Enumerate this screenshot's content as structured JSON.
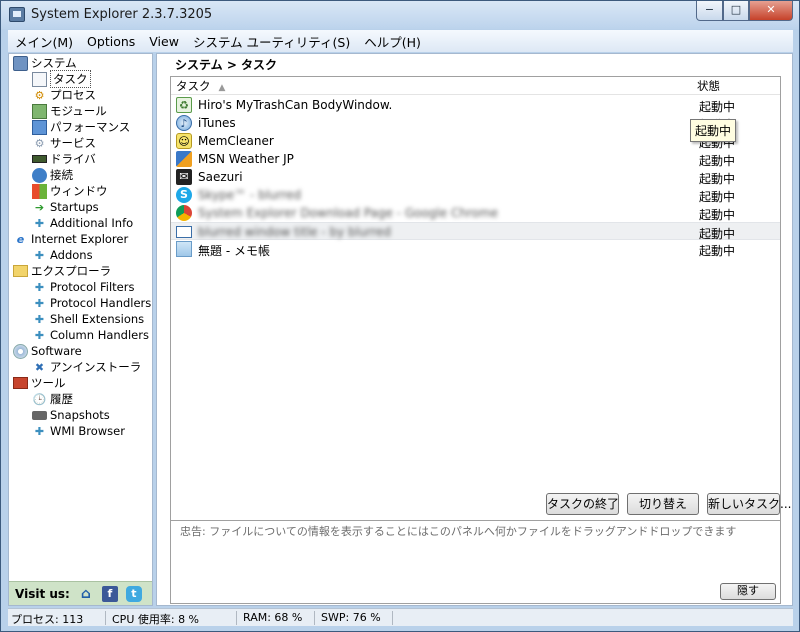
{
  "window": {
    "title": "System Explorer 2.3.7.3205",
    "min_label": "−",
    "max_label": "□",
    "close_label": "✕"
  },
  "menu": [
    "メイン(M)",
    "Options",
    "View",
    "システム ユーティリティ(S)",
    "ヘルプ(H)"
  ],
  "tree": [
    {
      "label": "システム",
      "icon": "computer-icon"
    },
    {
      "label": "タスク",
      "icon": "task-list-icon",
      "selected": true
    },
    {
      "label": "プロセス",
      "icon": "gear-icon"
    },
    {
      "label": "モジュール",
      "icon": "module-icon"
    },
    {
      "label": "パフォーマンス",
      "icon": "performance-icon"
    },
    {
      "label": "サービス",
      "icon": "service-gear-icon"
    },
    {
      "label": "ドライバ",
      "icon": "driver-chip-icon"
    },
    {
      "label": "接続",
      "icon": "globe-icon"
    },
    {
      "label": "ウィンドウ",
      "icon": "windows-flag-icon"
    },
    {
      "label": "Startups",
      "icon": "startup-arrow-icon"
    },
    {
      "label": "Additional Info",
      "icon": "puzzle-icon"
    },
    {
      "label": "Internet Explorer",
      "icon": "internet-explorer-icon"
    },
    {
      "label": "Addons",
      "icon": "puzzle-icon"
    },
    {
      "label": "エクスプローラ",
      "icon": "folder-icon"
    },
    {
      "label": "Protocol Filters",
      "icon": "puzzle-icon"
    },
    {
      "label": "Protocol Handlers",
      "icon": "puzzle-icon"
    },
    {
      "label": "Shell Extensions",
      "icon": "puzzle-icon"
    },
    {
      "label": "Column Handlers",
      "icon": "puzzle-icon"
    },
    {
      "label": "Software",
      "icon": "software-cd-icon"
    },
    {
      "label": "アンインストーラ",
      "icon": "uninstall-icon"
    },
    {
      "label": "ツール",
      "icon": "toolbox-icon"
    },
    {
      "label": "履歴",
      "icon": "clock-icon"
    },
    {
      "label": "Snapshots",
      "icon": "camera-icon"
    },
    {
      "label": "WMI Browser",
      "icon": "puzzle-icon"
    }
  ],
  "visit": {
    "label": "Visit us:",
    "home": "home-icon",
    "facebook": "f",
    "twitter": "t"
  },
  "breadcrumb": "システム > タスク",
  "grid": {
    "columns": {
      "task": "タスク",
      "state": "状態",
      "sort_indicator": "▲"
    },
    "rows": [
      {
        "name": "Hiro's MyTrashCan BodyWindow.",
        "state": "起動中",
        "icon": "trashcan-app-icon",
        "blurred": false
      },
      {
        "name": "iTunes",
        "state": "起動中",
        "icon": "itunes-icon",
        "blurred": false
      },
      {
        "name": "MemCleaner",
        "state": "起動中",
        "icon": "memcleaner-icon",
        "blurred": false
      },
      {
        "name": "MSN Weather JP",
        "state": "起動中",
        "icon": "weather-icon",
        "blurred": false
      },
      {
        "name": "Saezuri",
        "state": "起動中",
        "icon": "saezuri-icon",
        "blurred": false
      },
      {
        "name": "Skype™ - blurred",
        "state": "起動中",
        "icon": "skype-icon",
        "blurred": true
      },
      {
        "name": "System Explorer Download Page - Google Chrome",
        "state": "起動中",
        "icon": "chrome-icon",
        "blurred": true
      },
      {
        "name": "blurred window title - by blurred",
        "state": "起動中",
        "icon": "window-icon",
        "blurred": true,
        "highlighted": true
      },
      {
        "name": "無題 - メモ帳",
        "state": "起動中",
        "icon": "notepad-icon",
        "blurred": false
      }
    ],
    "tooltip": "起動中"
  },
  "buttons": {
    "end_task": "タスクの終了",
    "switch": "切り替え",
    "new_task": "新しいタスク..."
  },
  "info": {
    "text": "忠告: ファイルについての情報を表示することにはこのパネルへ何かファイルをドラッグアンドドロップできます",
    "hide": "隠す"
  },
  "status": {
    "processes": "プロセス: 113",
    "cpu": "CPU 使用率: 8 %",
    "ram": "RAM: 68 %",
    "swp": "SWP: 76 %"
  }
}
